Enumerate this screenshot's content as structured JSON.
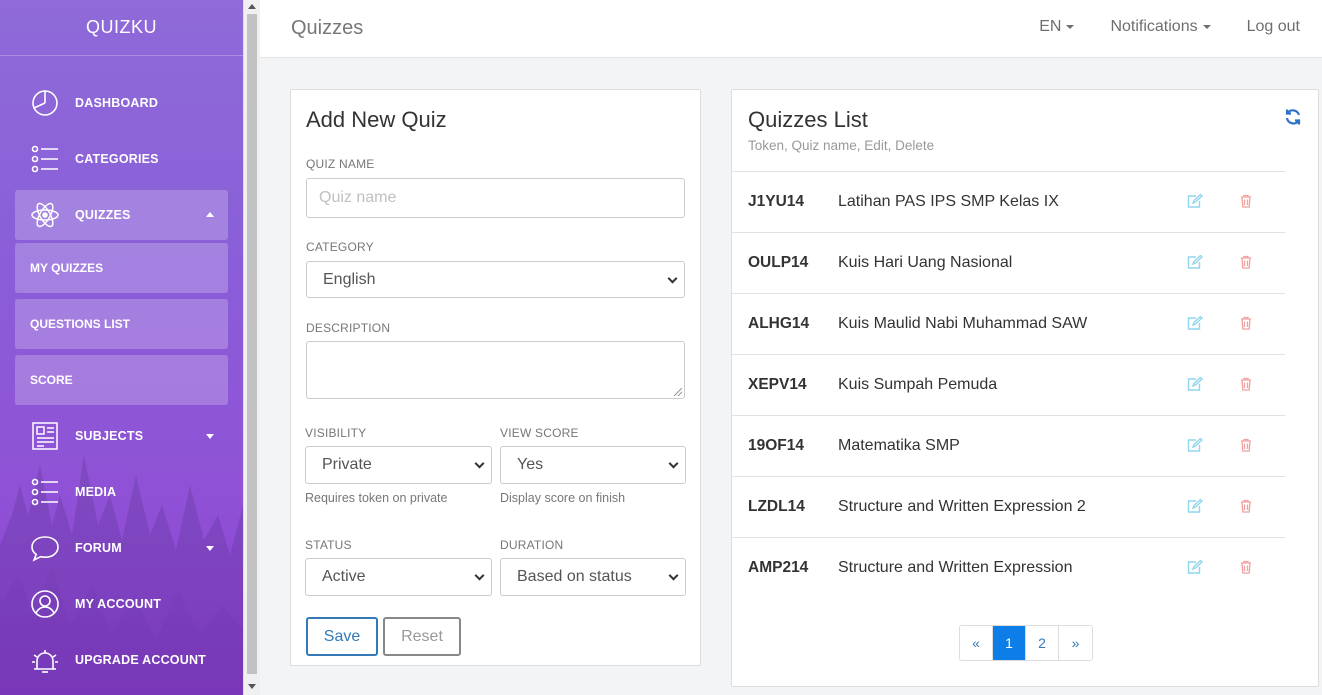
{
  "brand": "QUIZKU",
  "sidebar": {
    "items": [
      {
        "label": "DASHBOARD",
        "icon": "pie-chart-icon"
      },
      {
        "label": "CATEGORIES",
        "icon": "list-icon"
      },
      {
        "label": "QUIZZES",
        "icon": "atom-icon",
        "expanded": true
      },
      {
        "label": "SUBJECTS",
        "icon": "grid-icon"
      },
      {
        "label": "MEDIA",
        "icon": "list-icon"
      },
      {
        "label": "FORUM",
        "icon": "chat-icon"
      },
      {
        "label": "MY ACCOUNT",
        "icon": "user-icon"
      },
      {
        "label": "UPGRADE ACCOUNT",
        "icon": "bell-icon"
      }
    ],
    "sub_items": [
      "MY QUIZZES",
      "QUESTIONS LIST",
      "SCORE"
    ]
  },
  "topbar": {
    "title": "Quizzes",
    "lang": "EN",
    "notifications": "Notifications",
    "logout": "Log out"
  },
  "add_quiz": {
    "title": "Add New Quiz",
    "quiz_name_label": "QUIZ NAME",
    "quiz_name_placeholder": "Quiz name",
    "category_label": "CATEGORY",
    "category_value": "English",
    "description_label": "DESCRIPTION",
    "visibility_label": "VISIBILITY",
    "visibility_value": "Private",
    "visibility_help": "Requires token on private",
    "view_score_label": "VIEW SCORE",
    "view_score_value": "Yes",
    "view_score_help": "Display score on finish",
    "status_label": "STATUS",
    "status_value": "Active",
    "duration_label": "DURATION",
    "duration_value": "Based on status",
    "save_label": "Save",
    "reset_label": "Reset"
  },
  "quiz_list": {
    "title": "Quizzes List",
    "subtitle": "Token, Quiz name, Edit, Delete",
    "rows": [
      {
        "token": "J1YU14",
        "name": "Latihan PAS IPS SMP Kelas IX"
      },
      {
        "token": "OULP14",
        "name": "Kuis Hari Uang Nasional"
      },
      {
        "token": "ALHG14",
        "name": "Kuis Maulid Nabi Muhammad SAW"
      },
      {
        "token": "XEPV14",
        "name": "Kuis Sumpah Pemuda"
      },
      {
        "token": "19OF14",
        "name": "Matematika SMP"
      },
      {
        "token": "LZDL14",
        "name": "Structure and Written Expression 2"
      },
      {
        "token": "AMP214",
        "name": "Structure and Written Expression"
      }
    ],
    "pagination": {
      "prev": "«",
      "pages": [
        "1",
        "2"
      ],
      "next": "»",
      "current": "1"
    }
  },
  "colors": {
    "sidebar_top": "#8f6ad8",
    "sidebar_bottom": "#8a3fd0",
    "primary": "#337ab7",
    "page_active": "#0d7ee8",
    "edit_icon": "#8fd6ee",
    "delete_icon": "#f2a0a0"
  }
}
